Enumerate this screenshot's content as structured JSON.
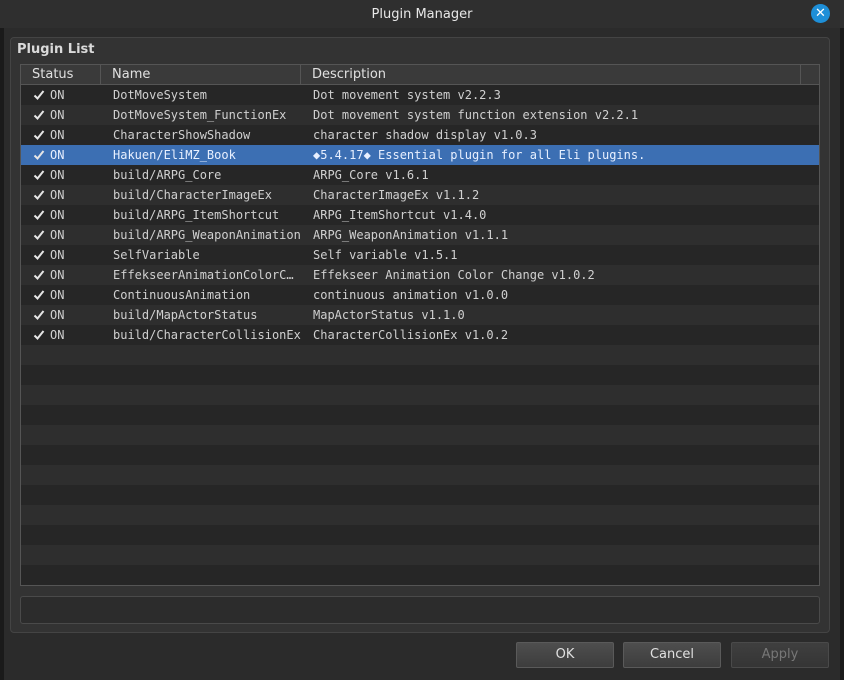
{
  "window": {
    "title": "Plugin Manager"
  },
  "panel": {
    "title": "Plugin List"
  },
  "columns": {
    "status": "Status",
    "name": "Name",
    "description": "Description"
  },
  "plugins": [
    {
      "status": "ON",
      "name": "DotMoveSystem",
      "description": "Dot movement system v2.2.3",
      "checked": true
    },
    {
      "status": "ON",
      "name": "DotMoveSystem_FunctionEx",
      "description": "Dot movement system function extension v2.2.1",
      "checked": true
    },
    {
      "status": "ON",
      "name": "CharacterShowShadow",
      "description": "character shadow display v1.0.3",
      "checked": true
    },
    {
      "status": "ON",
      "name": "Hakuen/EliMZ_Book",
      "description": "◆5.4.17◆ Essential plugin for all Eli plugins.",
      "checked": true,
      "selected": true
    },
    {
      "status": "ON",
      "name": "build/ARPG_Core",
      "description": "ARPG_Core v1.6.1",
      "checked": true
    },
    {
      "status": "ON",
      "name": "build/CharacterImageEx",
      "description": "CharacterImageEx v1.1.2",
      "checked": true
    },
    {
      "status": "ON",
      "name": "build/ARPG_ItemShortcut",
      "description": "ARPG_ItemShortcut v1.4.0",
      "checked": true
    },
    {
      "status": "ON",
      "name": "build/ARPG_WeaponAnimation",
      "description": "ARPG_WeaponAnimation v1.1.1",
      "checked": true
    },
    {
      "status": "ON",
      "name": "SelfVariable",
      "description": "Self variable v1.5.1",
      "checked": true
    },
    {
      "status": "ON",
      "name": "EffekseerAnimationColorC…",
      "description": "Effekseer Animation Color Change v1.0.2",
      "checked": true
    },
    {
      "status": "ON",
      "name": "ContinuousAnimation",
      "description": "continuous animation v1.0.0",
      "checked": true
    },
    {
      "status": "ON",
      "name": "build/MapActorStatus",
      "description": "MapActorStatus v1.1.0",
      "checked": true
    },
    {
      "status": "ON",
      "name": "build/CharacterCollisionEx",
      "description": "CharacterCollisionEx v1.0.2",
      "checked": true
    }
  ],
  "buttons": {
    "ok": "OK",
    "cancel": "Cancel",
    "apply": "Apply"
  },
  "colors": {
    "selection": "#3c6fb3",
    "close": "#1e8fd8"
  }
}
